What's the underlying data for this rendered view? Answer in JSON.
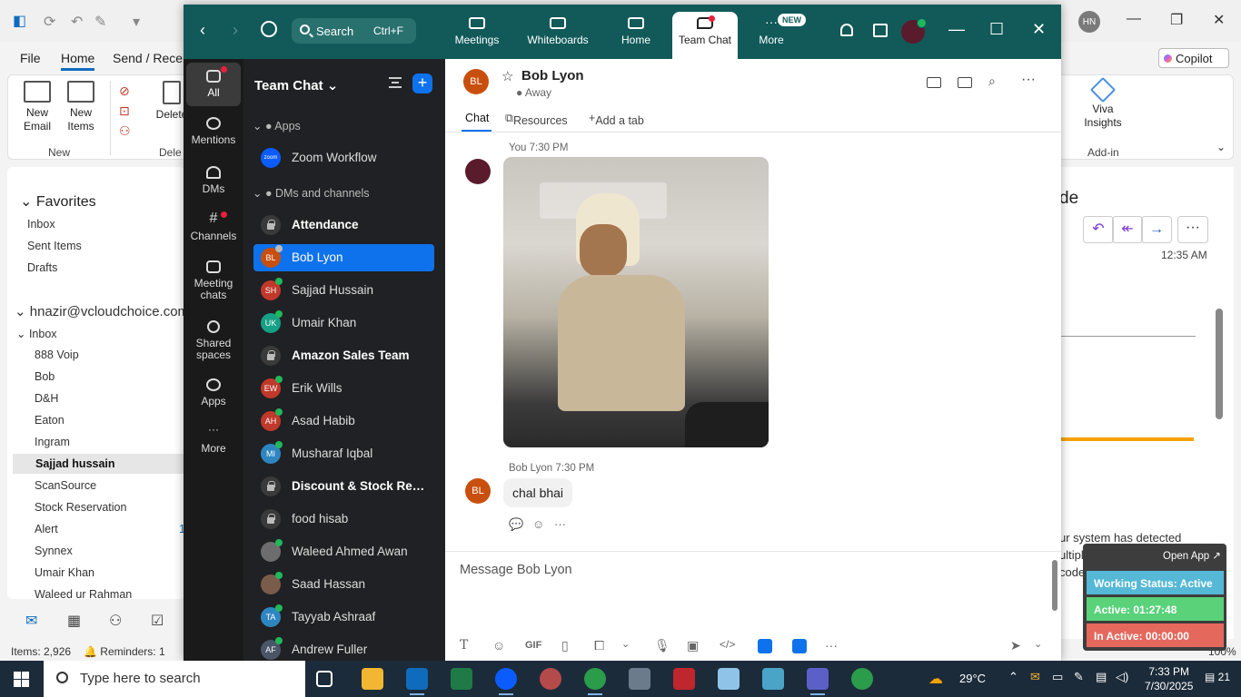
{
  "outlook": {
    "tabs": [
      "File",
      "Home",
      "Send / Receive"
    ],
    "ribbon": {
      "new_email": "New Email",
      "new_items": "New Items",
      "new_group": "New",
      "delete": "Delete",
      "delete_group": "Dele",
      "viva": "Viva Insights",
      "addin_group": "Add-in"
    },
    "copilot": "Copilot",
    "user_initials": "HN",
    "nav": {
      "favorites": "Favorites",
      "fav_items": [
        "Inbox",
        "Sent Items",
        "Drafts"
      ],
      "account": "hnazir@vcloudchoice.com",
      "inbox": "Inbox",
      "folders": [
        "888 Voip",
        "Bob",
        "D&H",
        "Eaton",
        "Ingram",
        "Sajjad hussain",
        "ScanSource",
        "Stock Reservation",
        "Alert",
        "Synnex",
        "Umair Khan",
        "Waleed ur Rahman"
      ],
      "alert_count": "1"
    },
    "status": {
      "items": "Items: 2,926",
      "reminders": "Reminders: 1",
      "zoom": "100%"
    },
    "reading": {
      "title_fragment": "de",
      "time": "12:35 AM",
      "body_line1": "ur system has detected",
      "body_line2": "ultiple users. To co",
      "body_line3": "code"
    }
  },
  "zoom": {
    "search": {
      "label": "Search",
      "shortcut": "Ctrl+F"
    },
    "top_tabs": [
      {
        "label": "Meetings"
      },
      {
        "label": "Whiteboards"
      },
      {
        "label": "Home"
      },
      {
        "label": "Team Chat"
      },
      {
        "label": "More",
        "badge": "NEW"
      }
    ],
    "rail": [
      "All",
      "Mentions",
      "DMs",
      "Channels",
      "Meeting chats",
      "Shared spaces",
      "Apps",
      "More"
    ],
    "list": {
      "title": "Team Chat",
      "apps_section": "Apps",
      "zoom_workflow": "Zoom Workflow",
      "dms_section": "DMs and channels",
      "rows": [
        {
          "name": "Attendance",
          "initials": "",
          "type": "lock",
          "bold": true
        },
        {
          "name": "Bob Lyon",
          "initials": "BL",
          "type": "user",
          "color": "#c94f0e",
          "selected": true
        },
        {
          "name": "Sajjad Hussain",
          "initials": "SH",
          "type": "user",
          "color": "#c0392b"
        },
        {
          "name": "Umair Khan",
          "initials": "UK",
          "type": "user",
          "color": "#16a085"
        },
        {
          "name": "Amazon Sales Team",
          "initials": "",
          "type": "lock",
          "bold": true
        },
        {
          "name": "Erik Wills",
          "initials": "EW",
          "type": "user",
          "color": "#c0392b"
        },
        {
          "name": "Asad Habib",
          "initials": "AH",
          "type": "user",
          "color": "#c0392b"
        },
        {
          "name": "Musharaf Iqbal",
          "initials": "MI",
          "type": "user",
          "color": "#2e86c1"
        },
        {
          "name": "Discount & Stock Res...",
          "initials": "",
          "type": "lock",
          "bold": true
        },
        {
          "name": "food hisab",
          "initials": "",
          "type": "lock"
        },
        {
          "name": "Waleed Ahmed Awan",
          "initials": "",
          "type": "photo",
          "color": "#6d6d6d"
        },
        {
          "name": "Saad Hassan",
          "initials": "",
          "type": "photo",
          "color": "#7a5c4a"
        },
        {
          "name": "Tayyab Ashraaf",
          "initials": "TA",
          "type": "user",
          "color": "#2e86c1"
        },
        {
          "name": "Andrew Fuller",
          "initials": "AF",
          "type": "user",
          "color": "#4a5568"
        }
      ]
    },
    "chat": {
      "contact": "Bob Lyon",
      "initials": "BL",
      "status": "Away",
      "tabs": [
        "Chat",
        "Resources",
        "Add a tab"
      ],
      "messages": [
        {
          "sender": "You",
          "time": "7:30 PM",
          "kind": "image"
        },
        {
          "sender": "Bob Lyon",
          "time": "7:30 PM",
          "kind": "text",
          "text": "chal bhai"
        }
      ],
      "composer_placeholder": "Message Bob Lyon",
      "gif_label": "GIF"
    }
  },
  "widget": {
    "open_app": "Open App ↗",
    "working": "Working Status: Active",
    "active": "Active: 01:27:48",
    "inactive": "In Active: 00:00:00"
  },
  "taskbar": {
    "search_placeholder": "Type here to search",
    "weather": "29°C",
    "time": "7:33 PM",
    "date": "7/30/2025",
    "notifications": "21"
  }
}
